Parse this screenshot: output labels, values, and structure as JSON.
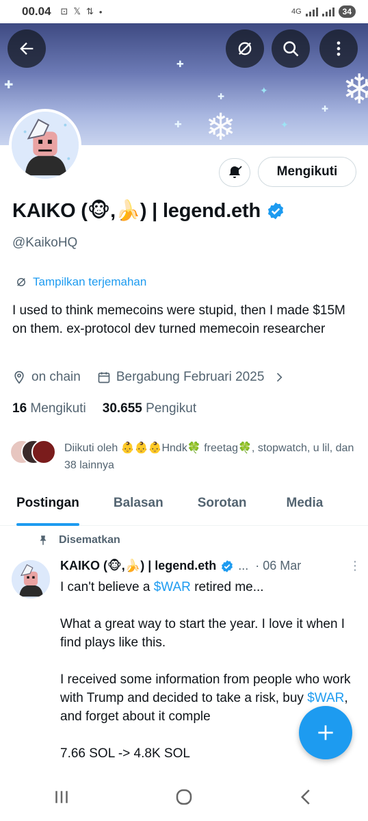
{
  "status_bar": {
    "time": "00.04",
    "network": "4G",
    "battery": "34"
  },
  "banner": {
    "back_icon": "arrow-left-icon",
    "translate_icon": "translate-slash-icon",
    "search_icon": "search-icon",
    "more_icon": "more-vertical-icon"
  },
  "profile": {
    "name": "KAIKO (🐵,🍌) | legend.eth",
    "handle": "@KaikoHQ",
    "follow_button": "Mengikuti",
    "translate_link": "Tampilkan terjemahan",
    "bio": "I used to think memecoins were stupid, then I made $15M on them.  ex-protocol dev turned memecoin researcher",
    "location": "on chain",
    "joined": "Bergabung Februari 2025",
    "following_count": "16",
    "following_label": "Mengikuti",
    "followers_count": "30.655",
    "followers_label": "Pengikut",
    "followed_by": "Diikuti oleh 👶👶👶Hndk🍀 freetag🍀, stopwatch, u lil, dan 38 lainnya"
  },
  "tabs": [
    {
      "label": "Postingan",
      "active": true
    },
    {
      "label": "Balasan",
      "active": false
    },
    {
      "label": "Sorotan",
      "active": false
    },
    {
      "label": "Media",
      "active": false
    }
  ],
  "post": {
    "pinned_label": "Disematkan",
    "author": "KAIKO (🐵,🍌) | legend.eth",
    "ellipsis": "...",
    "date": "· 06 Mar",
    "line1_prefix": "I can't believe a ",
    "line1_tag": "$WAR",
    "line1_suffix": " retired me...",
    "para2": "What a great way to start the year. I love it when I find plays like this.",
    "para3_prefix": "I received some information from people who work with Trump and decided to take a risk, buy ",
    "para3_tag": "$WAR",
    "para3_suffix": ", and forget about it comple",
    "para4": "7.66 SOL -> 4.8K SOL"
  },
  "colors": {
    "accent": "#1d9bf0",
    "text": "#0f1419",
    "muted": "#536471"
  }
}
